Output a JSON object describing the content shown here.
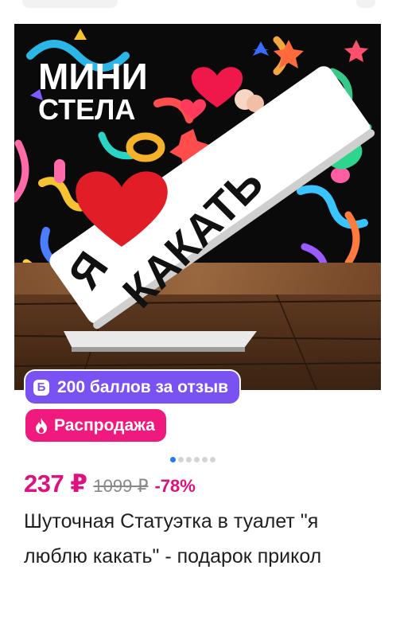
{
  "product": {
    "image": {
      "headline_line1": "МИНИ",
      "headline_line2": "СТЕЛА",
      "sign_letter": "Я",
      "sign_word": "КАКАТЬ",
      "heart_color": "#e11d28",
      "sign_color": "#ffffff",
      "background_color": "#0a0a0a"
    },
    "review_badge": {
      "icon": "points-b-icon",
      "icon_glyph": "Б",
      "label": "200 баллов за отзыв",
      "color": "#7b52f2"
    },
    "sale_badge": {
      "icon": "flame-icon",
      "label": "Распродажа",
      "color": "#f0197d"
    },
    "carousel": {
      "total": 6,
      "active_index": 0,
      "active_color": "#1f7aff"
    },
    "price": {
      "current": "237 ₽",
      "old": "1099 ₽",
      "discount": "-78%",
      "accent_color": "#e0117f"
    },
    "title": "Шуточная Статуэтка в туалет \"я люблю какать\" - подарок прикол"
  }
}
